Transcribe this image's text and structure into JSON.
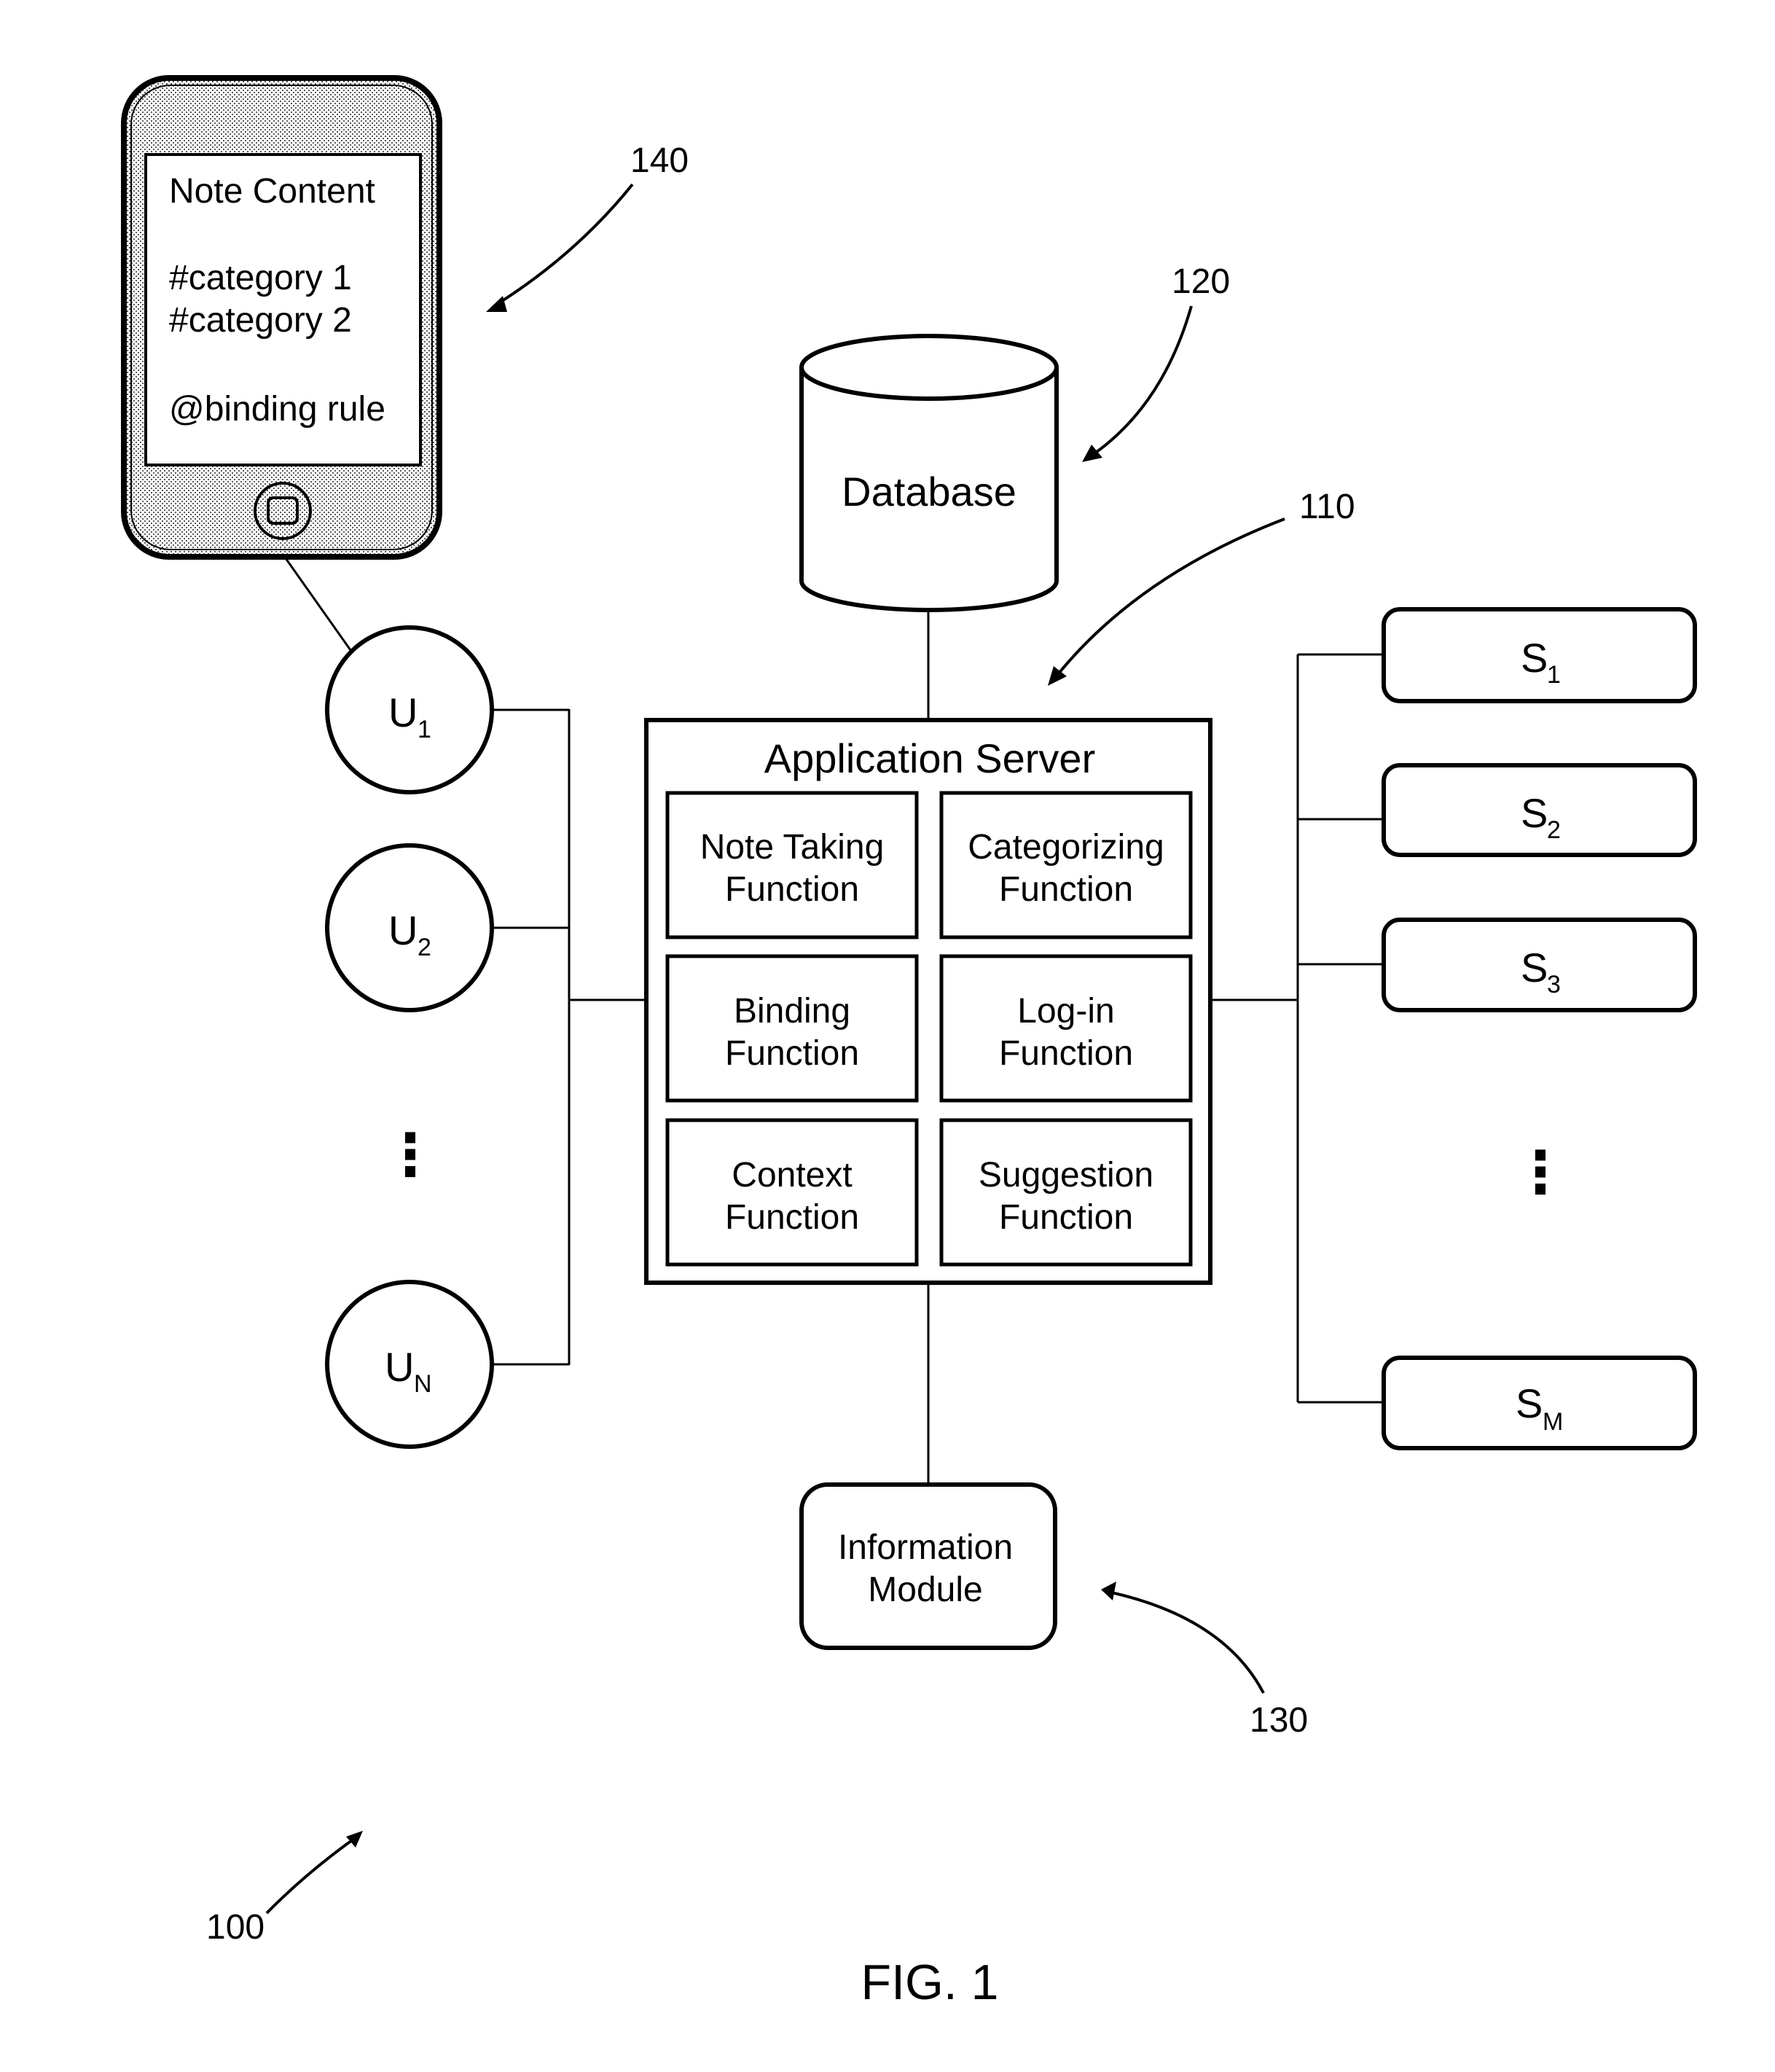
{
  "figure": {
    "caption": "FIG. 1",
    "system_ref": "100"
  },
  "phone": {
    "ref": "140",
    "lines": [
      "Note Content",
      "#category 1",
      "#category 2",
      "@binding rule"
    ],
    "home_button_icon": "home-button-icon"
  },
  "database": {
    "ref": "120",
    "label": "Database"
  },
  "app_server": {
    "ref": "110",
    "title": "Application Server",
    "functions": [
      {
        "line1": "Note Taking",
        "line2": "Function"
      },
      {
        "line1": "Categorizing",
        "line2": "Function"
      },
      {
        "line1": "Binding",
        "line2": "Function"
      },
      {
        "line1": "Log-in",
        "line2": "Function"
      },
      {
        "line1": "Context",
        "line2": "Function"
      },
      {
        "line1": "Suggestion",
        "line2": "Function"
      }
    ]
  },
  "info_module": {
    "ref": "130",
    "line1": "Information",
    "line2": "Module"
  },
  "users": {
    "items": [
      {
        "base": "U",
        "sub": "1"
      },
      {
        "base": "U",
        "sub": "2"
      },
      {
        "base": "U",
        "sub": "N"
      }
    ],
    "ellipsis": "⋮"
  },
  "servers": {
    "items": [
      {
        "base": "S",
        "sub": "1"
      },
      {
        "base": "S",
        "sub": "2"
      },
      {
        "base": "S",
        "sub": "3"
      },
      {
        "base": "S",
        "sub": "M"
      }
    ],
    "ellipsis": "⋮"
  }
}
